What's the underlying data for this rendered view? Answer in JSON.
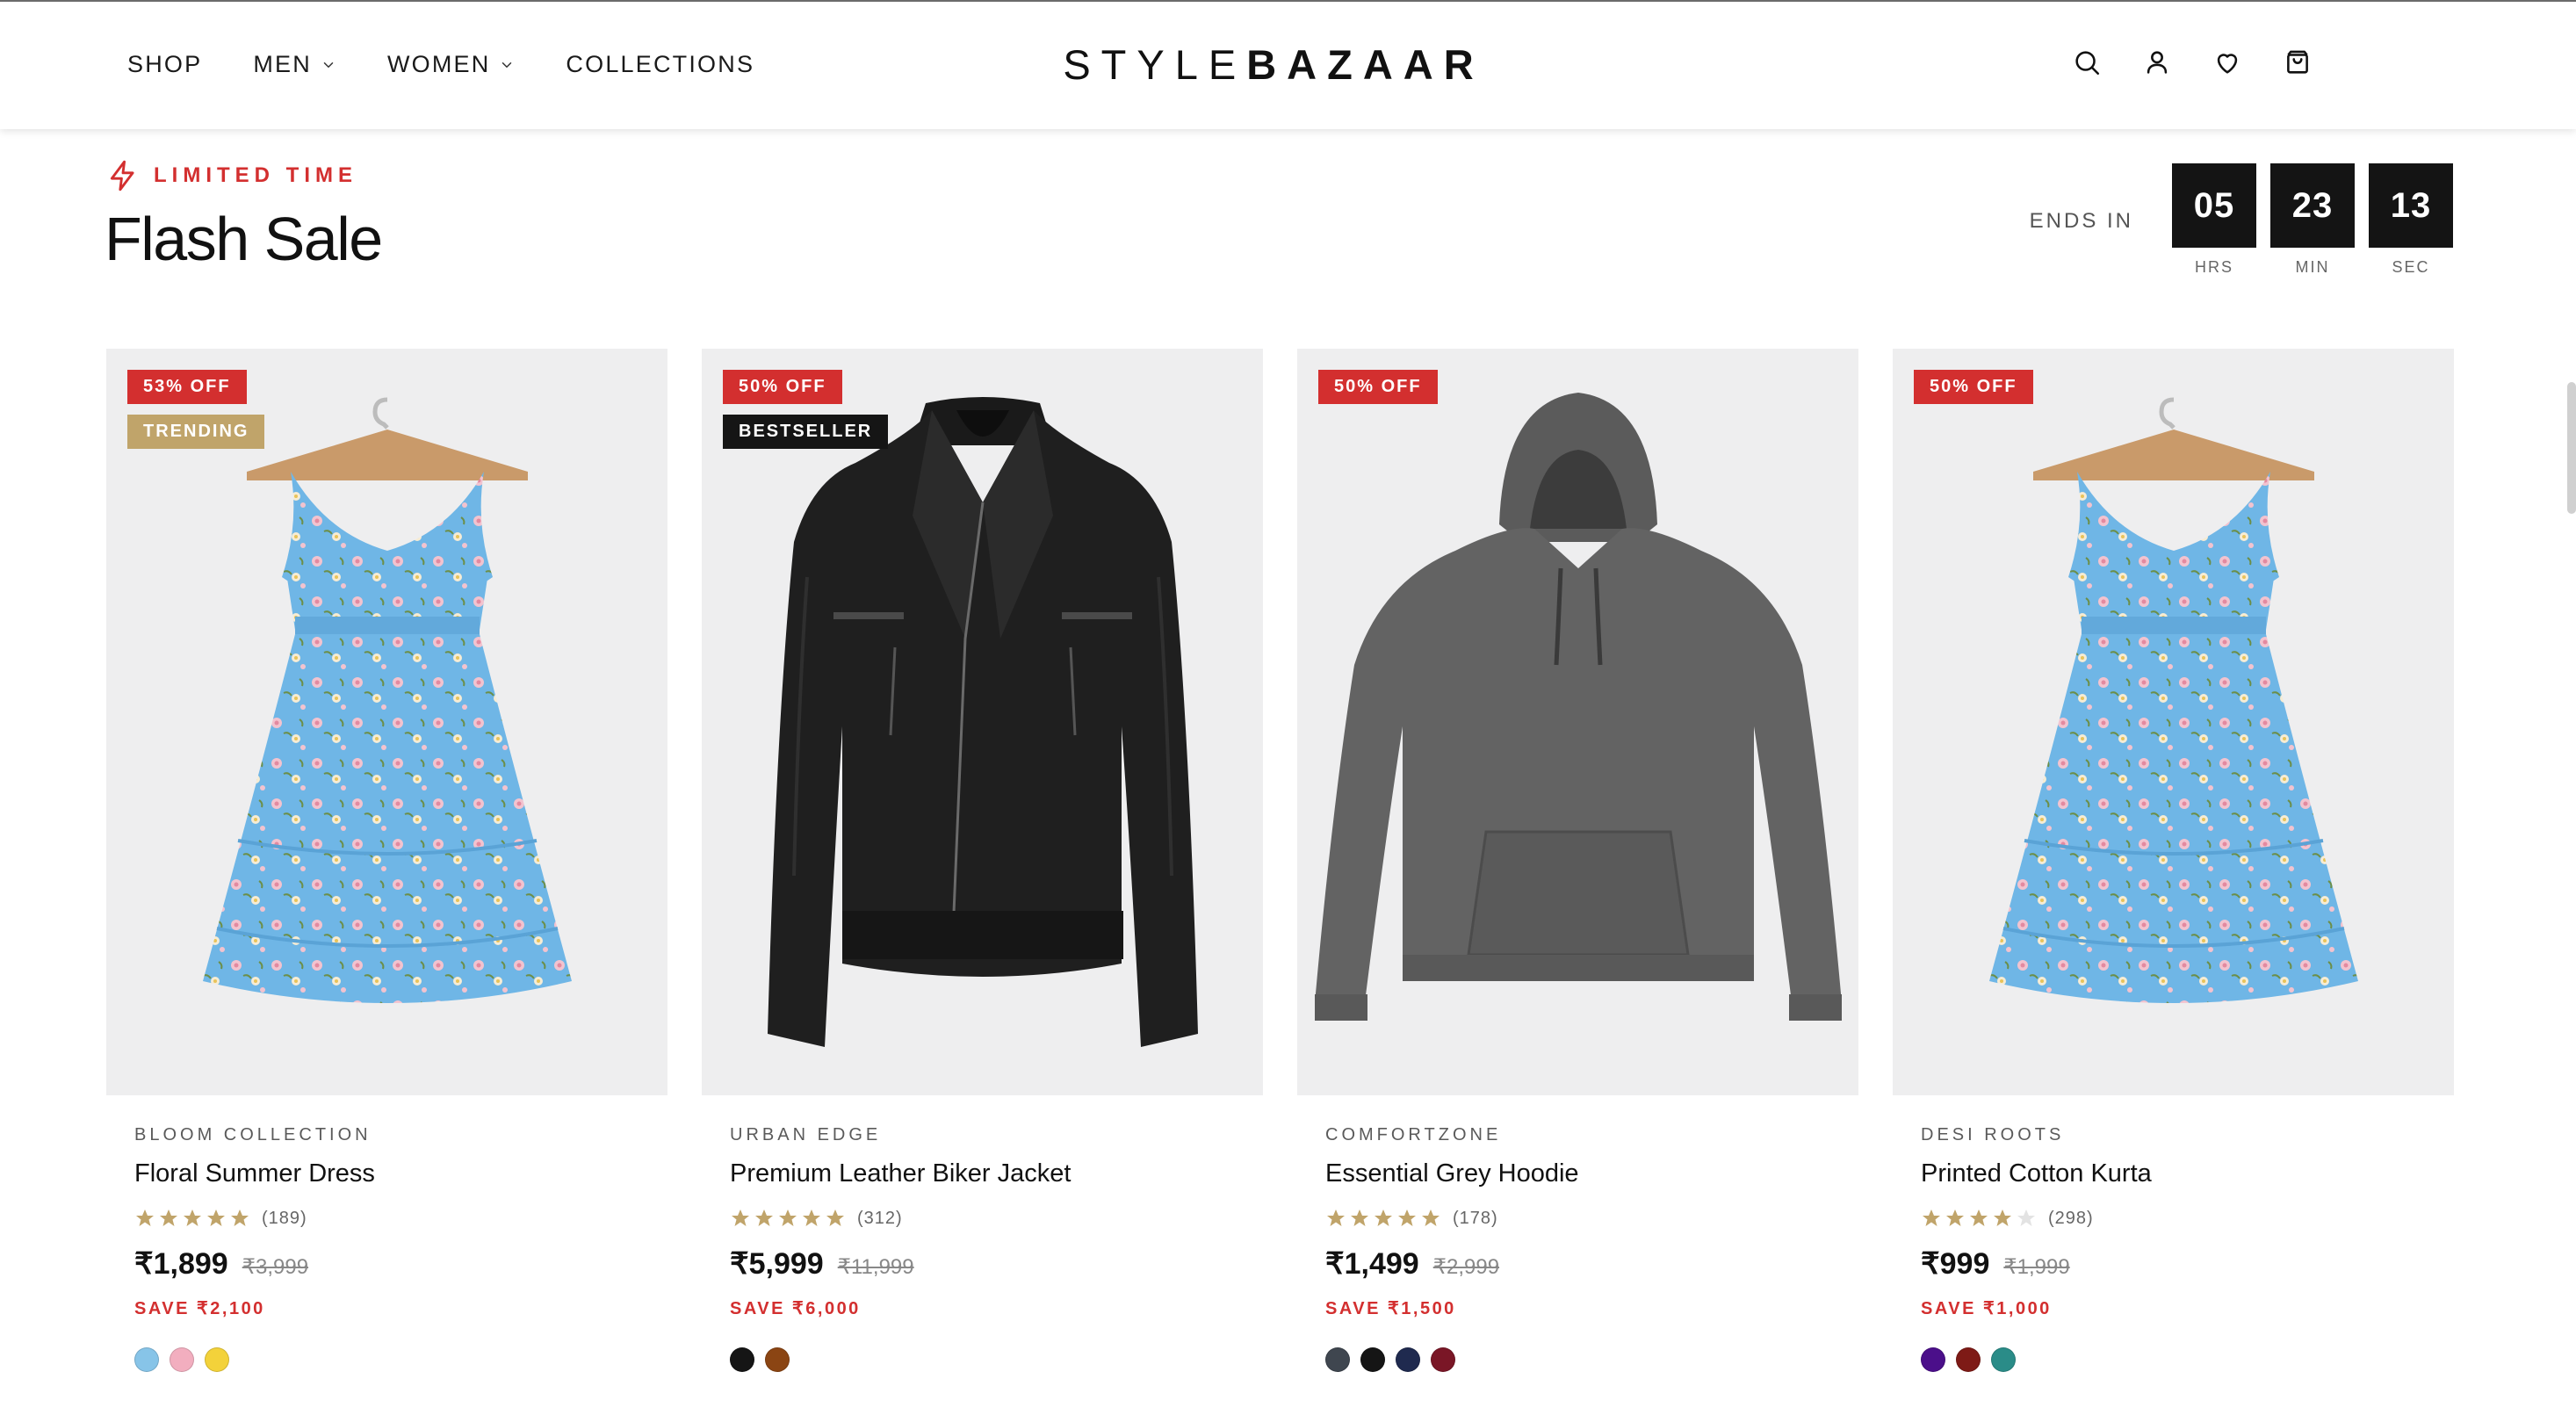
{
  "header": {
    "nav": [
      {
        "label": "SHOP",
        "dropdown": false
      },
      {
        "label": "MEN",
        "dropdown": true
      },
      {
        "label": "WOMEN",
        "dropdown": true
      },
      {
        "label": "COLLECTIONS",
        "dropdown": false
      }
    ],
    "logo_light": "STYLE",
    "logo_bold": "BAZAAR",
    "icons": [
      "search-icon",
      "account-icon",
      "wishlist-heart-icon",
      "shopping-bag-icon"
    ]
  },
  "flash_sale": {
    "eyebrow": "LIMITED TIME",
    "eyebrow_icon": "lightning-icon",
    "title": "Flash Sale",
    "ends_in_label": "ENDS IN",
    "countdown": [
      {
        "value": "05",
        "label": "HRS"
      },
      {
        "value": "23",
        "label": "MIN"
      },
      {
        "value": "13",
        "label": "SEC"
      }
    ]
  },
  "colors": {
    "accent_red": "#d32f2f",
    "badge_gold": "#c0a46a",
    "badge_black": "#151515",
    "star_gold": "#c0a46a",
    "countdown_bg": "#141414"
  },
  "products": [
    {
      "badges": [
        {
          "text": "53% OFF",
          "style": "red"
        },
        {
          "text": "TRENDING",
          "style": "gold"
        }
      ],
      "image": "floral-dress",
      "brand": "BLOOM COLLECTION",
      "name": "Floral Summer Dress",
      "rating": 5,
      "reviews": "(189)",
      "price": "₹1,899",
      "old_price": "₹3,999",
      "save": "SAVE ₹2,100",
      "swatches": [
        "#87c4e8",
        "#f2aebf",
        "#f3d23a"
      ]
    },
    {
      "badges": [
        {
          "text": "50% OFF",
          "style": "red"
        },
        {
          "text": "BESTSELLER",
          "style": "black"
        }
      ],
      "image": "leather-jacket",
      "brand": "URBAN EDGE",
      "name": "Premium Leather Biker Jacket",
      "rating": 5,
      "reviews": "(312)",
      "price": "₹5,999",
      "old_price": "₹11,999",
      "save": "SAVE ₹6,000",
      "swatches": [
        "#151515",
        "#8b4513"
      ]
    },
    {
      "badges": [
        {
          "text": "50% OFF",
          "style": "red"
        }
      ],
      "image": "grey-hoodie",
      "brand": "COMFORTZONE",
      "name": "Essential Grey Hoodie",
      "rating": 5,
      "reviews": "(178)",
      "price": "₹1,499",
      "old_price": "₹2,999",
      "save": "SAVE ₹1,500",
      "swatches": [
        "#3f464f",
        "#151515",
        "#1f2a4f",
        "#7a1626"
      ]
    },
    {
      "badges": [
        {
          "text": "50% OFF",
          "style": "red"
        }
      ],
      "image": "floral-dress",
      "brand": "DESI ROOTS",
      "name": "Printed Cotton Kurta",
      "rating": 4,
      "reviews": "(298)",
      "price": "₹999",
      "old_price": "₹1,999",
      "save": "SAVE ₹1,000",
      "swatches": [
        "#4b0f8a",
        "#7e1a16",
        "#2a8c88"
      ]
    }
  ]
}
